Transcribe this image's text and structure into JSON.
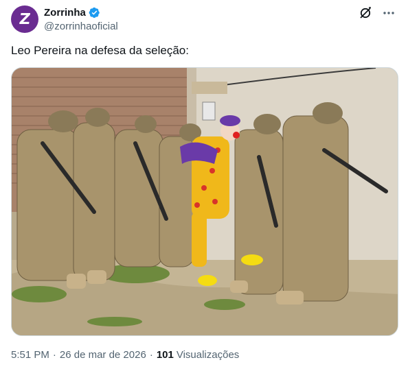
{
  "author": {
    "display_name": "Zorrinha",
    "handle": "@zorrinhaoficial",
    "avatar_letter": "Z",
    "avatar_color": "#6a2c91",
    "verified": true,
    "verified_color": "#1d9bf0"
  },
  "tweet": {
    "text": "Leo Pereira na defesa da seleção:"
  },
  "meta": {
    "time": "5:51 PM",
    "separator": "·",
    "date": "26 de mar de 2026",
    "views_count": "101",
    "views_label": "Visualizações"
  },
  "icons": {
    "grok": "grok-icon",
    "more": "more-icon",
    "verified": "verified-badge-icon"
  }
}
